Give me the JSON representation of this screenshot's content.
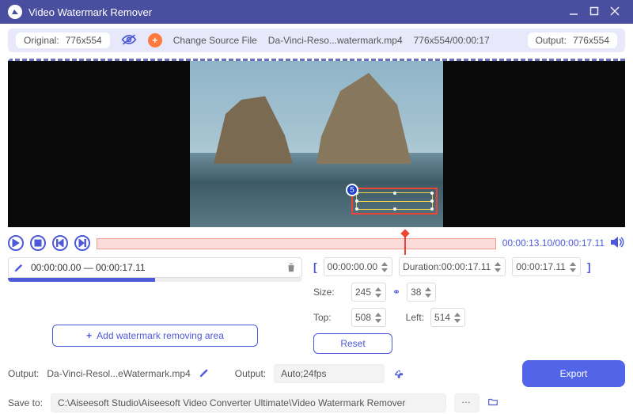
{
  "title": "Video Watermark Remover",
  "toolbar": {
    "original_label": "Original:",
    "original_dim": "776x554",
    "change_source": "Change Source File",
    "file_name": "Da-Vinci-Reso...watermark.mp4",
    "src_dim": "776x554",
    "src_dur": "00:00:17",
    "output_label": "Output:",
    "output_dim": "776x554",
    "wm_tag": "5"
  },
  "transport": {
    "pos": "00:00:13.10",
    "total": "00:00:17.11",
    "cursor_pct": 77
  },
  "segment": {
    "range_text": "00:00:00.00 — 00:00:17.11",
    "add_label": "Add watermark removing area"
  },
  "params": {
    "start": "00:00:00.00",
    "dur_label": "Duration:",
    "duration": "00:00:17.11",
    "end": "00:00:17.11",
    "size_label": "Size:",
    "w": "245",
    "h": "38",
    "top_label": "Top:",
    "top": "508",
    "left_label": "Left:",
    "left": "514",
    "reset": "Reset"
  },
  "bottom": {
    "output_label": "Output:",
    "output_name": "Da-Vinci-Resol...eWatermark.mp4",
    "fmt_label": "Output:",
    "fmt_value": "Auto;24fps",
    "save_label": "Save to:",
    "save_path": "C:\\Aiseesoft Studio\\Aiseesoft Video Converter Ultimate\\Video Watermark Remover",
    "export": "Export"
  }
}
